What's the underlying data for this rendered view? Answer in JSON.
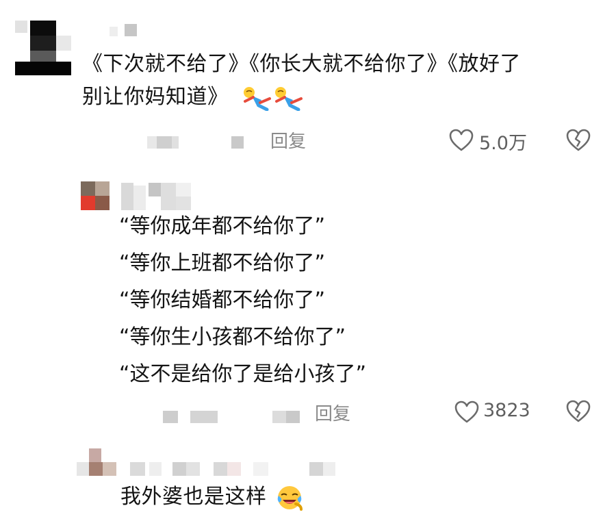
{
  "comments": [
    {
      "id": "comment-1",
      "lines": [
        "《下次就不给了》《你长大就不给你了》《放好了",
        "别让你妈知道》"
      ],
      "emojis": [
        "running-person-emoji",
        "running-person-emoji"
      ],
      "reply_label": "回复",
      "like_count": "5.0万",
      "icons": {
        "like": "heart-outline-icon",
        "dislike": "broken-heart-icon"
      }
    },
    {
      "id": "comment-2",
      "lines": [
        "“等你成年都不给你了”",
        "“等你上班都不给你了”",
        "“等你结婚都不给你了”",
        "“等你生小孩都不给你了”",
        "“这不是给你了是给小孩了”"
      ],
      "reply_label": "回复",
      "like_count": "3823",
      "icons": {
        "like": "heart-outline-icon",
        "dislike": "broken-heart-icon"
      }
    },
    {
      "id": "comment-3",
      "lines": [
        "我外婆也是这样"
      ],
      "emojis": [
        "laughing-crying-emoji"
      ]
    }
  ],
  "colors": {
    "text": "#141414",
    "meta": "#8a8a8a",
    "icon": "#6b6b6b",
    "background": "#ffffff"
  }
}
